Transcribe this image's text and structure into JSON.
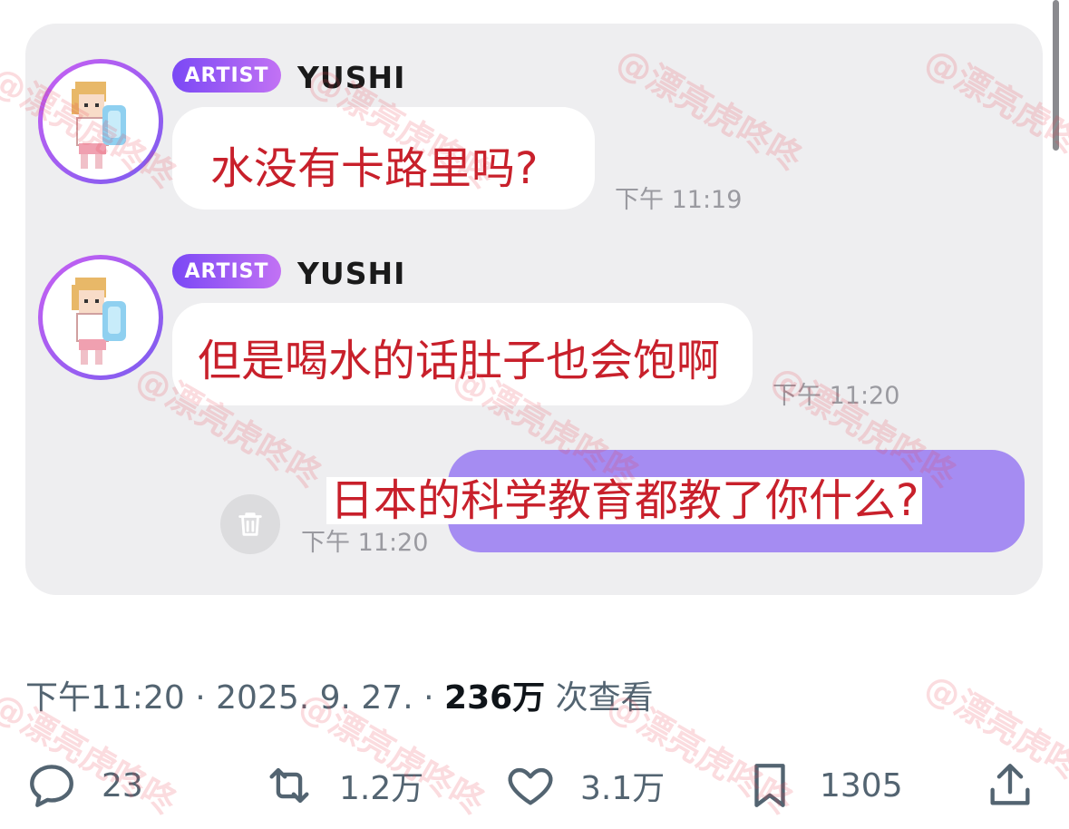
{
  "messages": [
    {
      "badge": "ARTIST",
      "sender": "YUSHI",
      "text": "水没有卡路里吗?",
      "time": "下午 11:19"
    },
    {
      "badge": "ARTIST",
      "sender": "YUSHI",
      "text": "但是喝水的话肚子也会饱啊",
      "time": "下午 11:20"
    },
    {
      "text": "日本的科学教育都教了你什么?",
      "time": "下午 11:20"
    }
  ],
  "post_meta": {
    "time": "下午11:20",
    "separator": "·",
    "date": "2025. 9. 27.",
    "views": "236万",
    "views_label": "次查看"
  },
  "actions": {
    "replies": "23",
    "reposts": "1.2万",
    "likes": "3.1万",
    "bookmarks": "1305"
  },
  "watermark": "@漂亮虎咚咚",
  "colors": {
    "badge_gradient_start": "#7a48f5",
    "badge_gradient_end": "#c272f4",
    "outgoing_bubble": "#a58cf2",
    "caption_text": "#c8202b",
    "panel_background": "#eeeef0"
  }
}
